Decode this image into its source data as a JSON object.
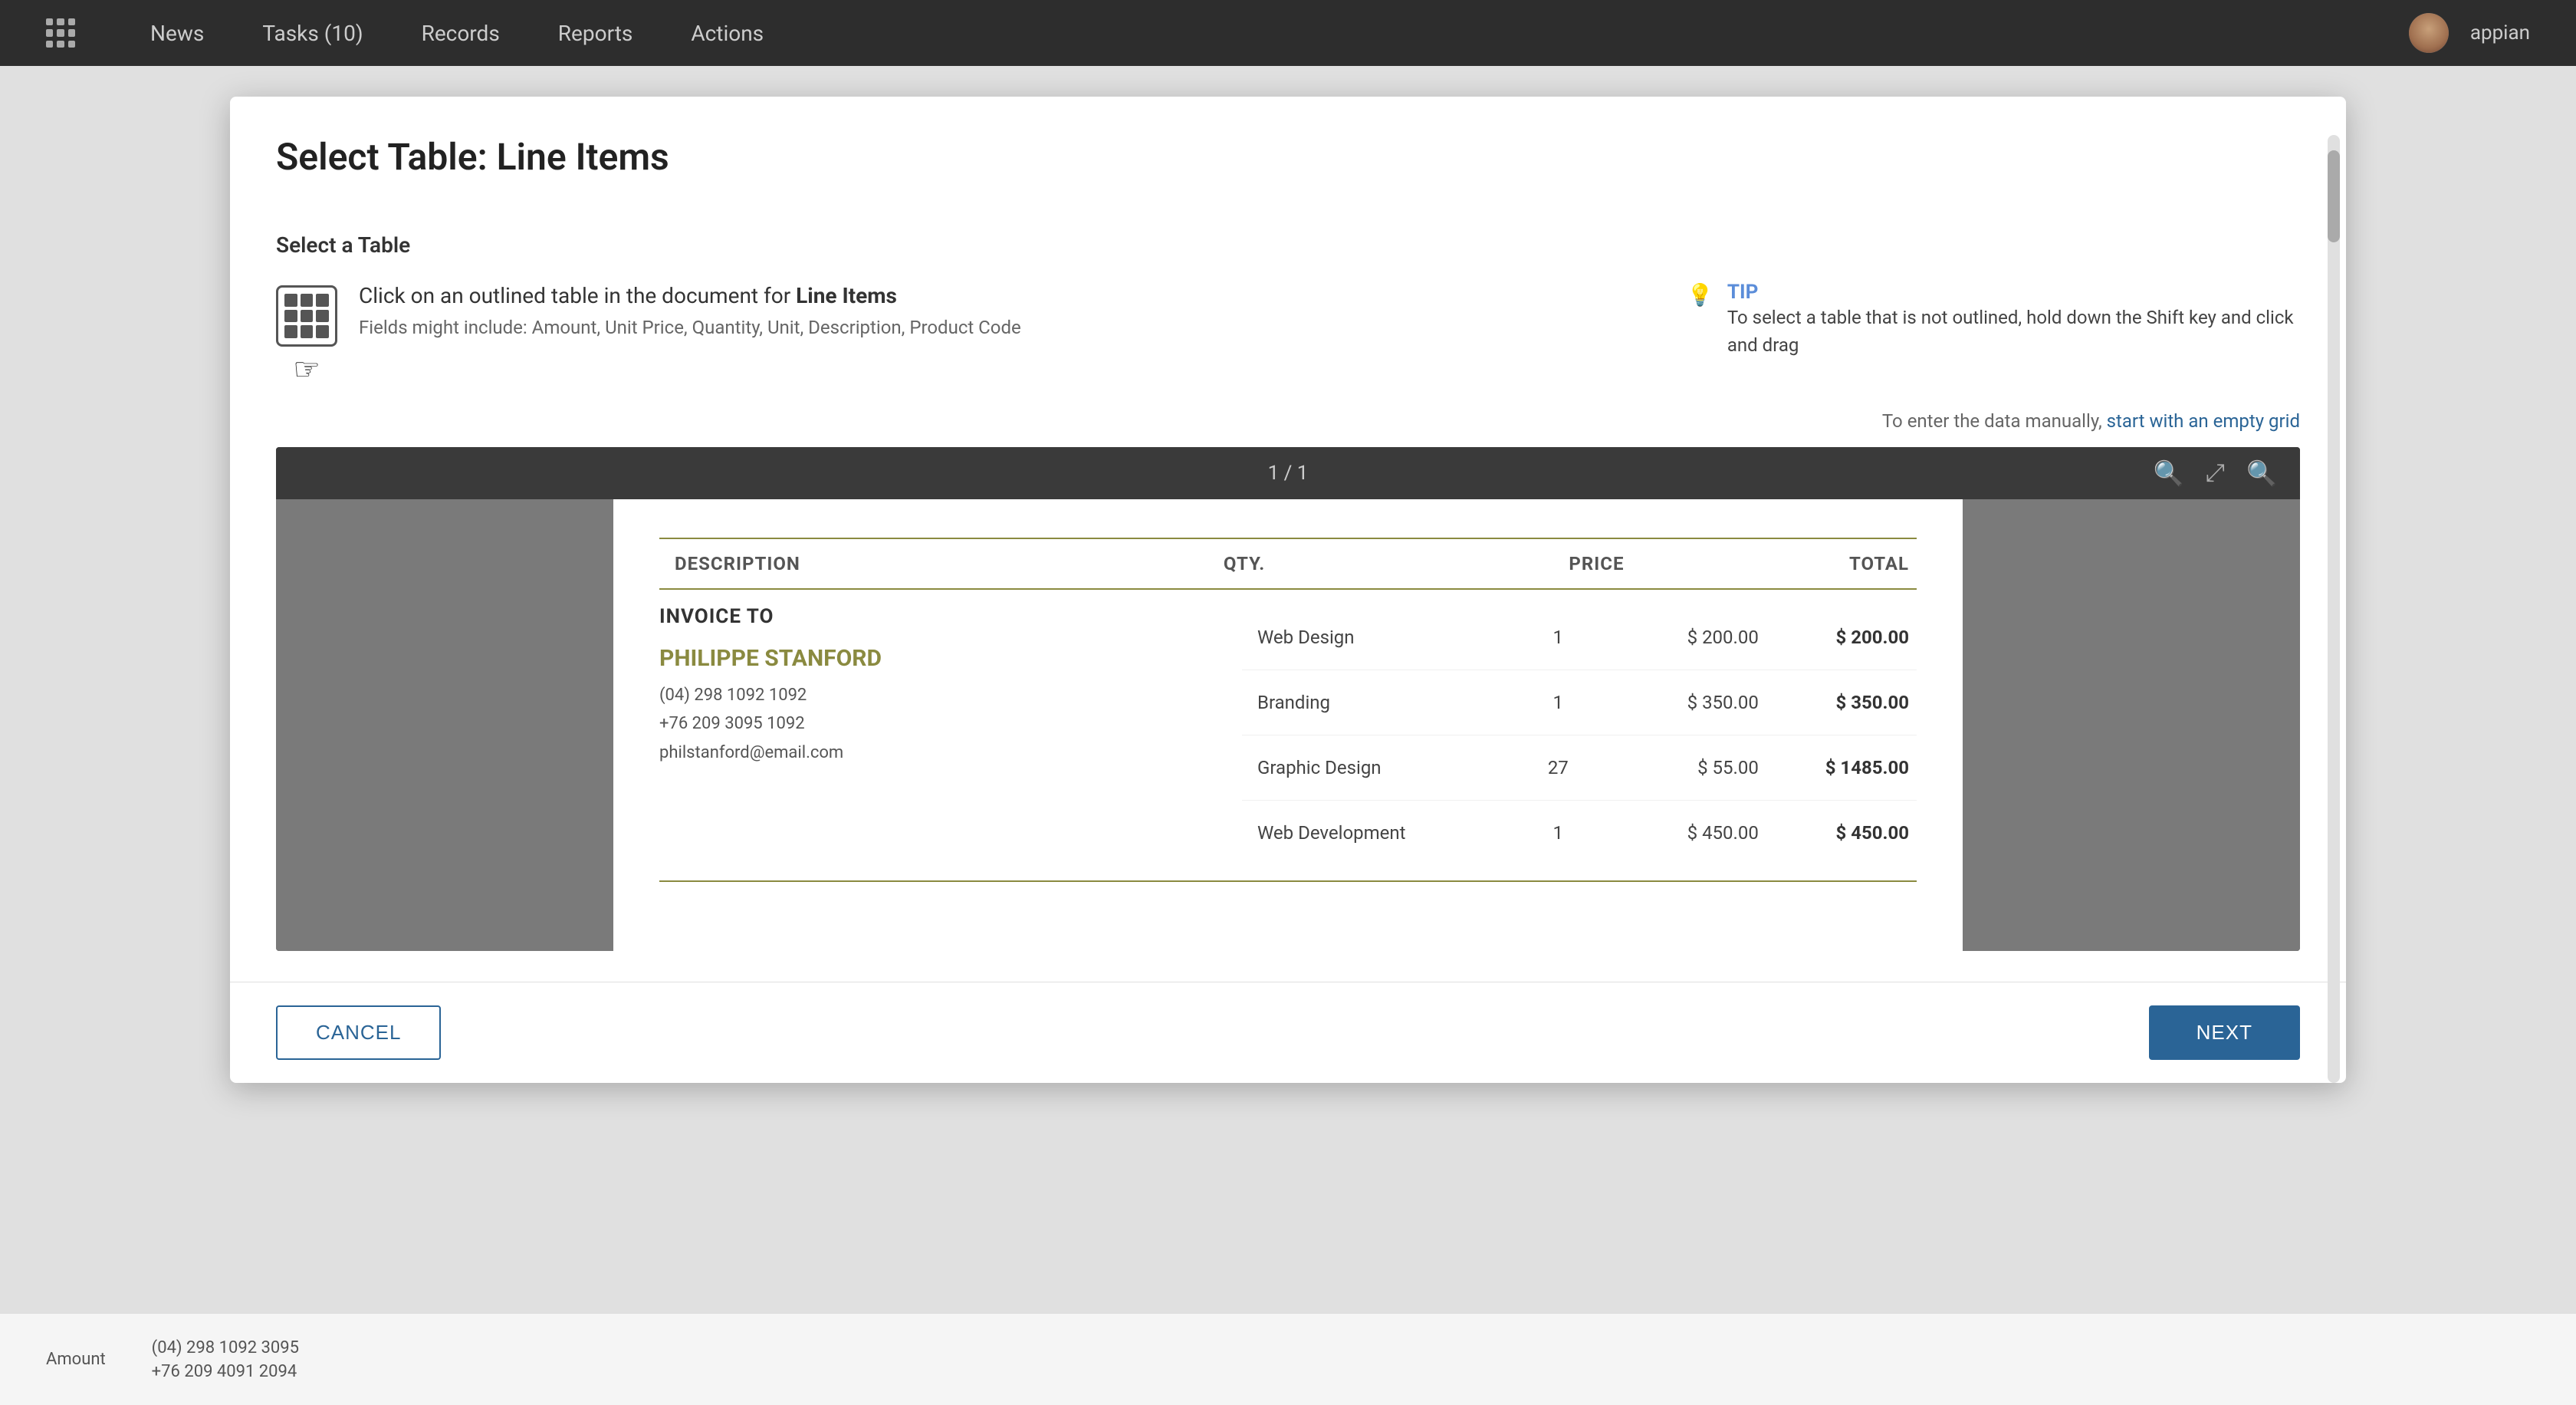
{
  "nav": {
    "items": [
      {
        "label": "News",
        "id": "news"
      },
      {
        "label": "Tasks (10)",
        "id": "tasks"
      },
      {
        "label": "Records",
        "id": "records"
      },
      {
        "label": "Reports",
        "id": "reports"
      },
      {
        "label": "Actions",
        "id": "actions"
      }
    ],
    "username": "appian",
    "grid_icon": "grid-icon"
  },
  "modal": {
    "title": "Select Table: Line Items",
    "select_table_label": "Select a Table",
    "info_main_text": "Click on an outlined table in the document for",
    "info_link_text": "Line Items",
    "info_sub_text": "Fields might include: Amount, Unit Price, Quantity, Unit, Description, Product Code",
    "tip_label": "TIP",
    "tip_text": "To select a table that is not outlined, hold down the Shift key and click and drag",
    "empty_grid_text": "To enter the data manually,",
    "empty_grid_link": "start with an empty grid",
    "page_info": "1 / 1"
  },
  "invoice": {
    "table_headers": {
      "description": "DESCRIPTION",
      "qty": "QTY.",
      "price": "PRICE",
      "total": "TOTAL"
    },
    "invoice_to_label": "INVOICE TO",
    "client_name": "PHILIPPE STANFORD",
    "client_phone1": "(04) 298 1092 1092",
    "client_phone2": "+76 209 3095 1092",
    "client_email": "philstanford@email.com",
    "rows": [
      {
        "desc": "Web Design",
        "qty": "1",
        "price": "$ 200.00",
        "total": "$ 200.00"
      },
      {
        "desc": "Branding",
        "qty": "1",
        "price": "$ 350.00",
        "total": "$ 350.00"
      },
      {
        "desc": "Graphic Design",
        "qty": "27",
        "price": "$ 55.00",
        "total": "$ 1485.00"
      },
      {
        "desc": "Web Development",
        "qty": "1",
        "price": "$ 450.00",
        "total": "$ 450.00"
      }
    ]
  },
  "footer": {
    "cancel_label": "CANCEL",
    "next_label": "NEXT"
  },
  "bottom_bar": {
    "amount_label": "Amount",
    "phone1": "(04) 298 1092 3095",
    "phone2": "+76 209 4091 2094"
  }
}
